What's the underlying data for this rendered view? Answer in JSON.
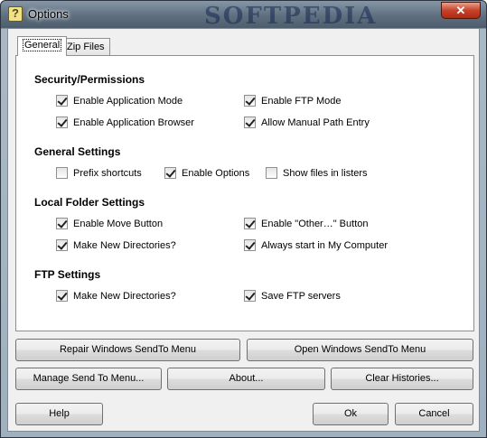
{
  "window": {
    "title": "Options",
    "close_glyph": "✕",
    "watermark": "SOFTPEDIA"
  },
  "tabs": [
    {
      "label": "General"
    },
    {
      "label": "Zip Files"
    }
  ],
  "sections": {
    "security": {
      "title": "Security/Permissions",
      "items": [
        {
          "label": "Enable Application Mode",
          "checked": true
        },
        {
          "label": "Enable FTP Mode",
          "checked": true
        },
        {
          "label": "Enable Application Browser",
          "checked": true
        },
        {
          "label": "Allow Manual Path Entry",
          "checked": true
        }
      ]
    },
    "general": {
      "title": "General Settings",
      "items": [
        {
          "label": "Prefix shortcuts",
          "checked": false
        },
        {
          "label": "Enable Options",
          "checked": true
        },
        {
          "label": "Show files in listers",
          "checked": false
        }
      ]
    },
    "local": {
      "title": "Local Folder Settings",
      "items": [
        {
          "label": "Enable Move Button",
          "checked": true
        },
        {
          "label": "Enable \"Other…\" Button",
          "checked": true
        },
        {
          "label": "Make New Directories?",
          "checked": true
        },
        {
          "label": "Always start in My Computer",
          "checked": true
        }
      ]
    },
    "ftp": {
      "title": "FTP Settings",
      "items": [
        {
          "label": "Make New Directories?",
          "checked": true
        },
        {
          "label": "Save FTP servers",
          "checked": true
        }
      ]
    }
  },
  "buttons": {
    "repair": "Repair Windows SendTo Menu",
    "open": "Open Windows SendTo Menu",
    "manage": "Manage Send To Menu...",
    "about": "About...",
    "clear": "Clear Histories...",
    "help": "Help",
    "ok": "Ok",
    "cancel": "Cancel"
  }
}
